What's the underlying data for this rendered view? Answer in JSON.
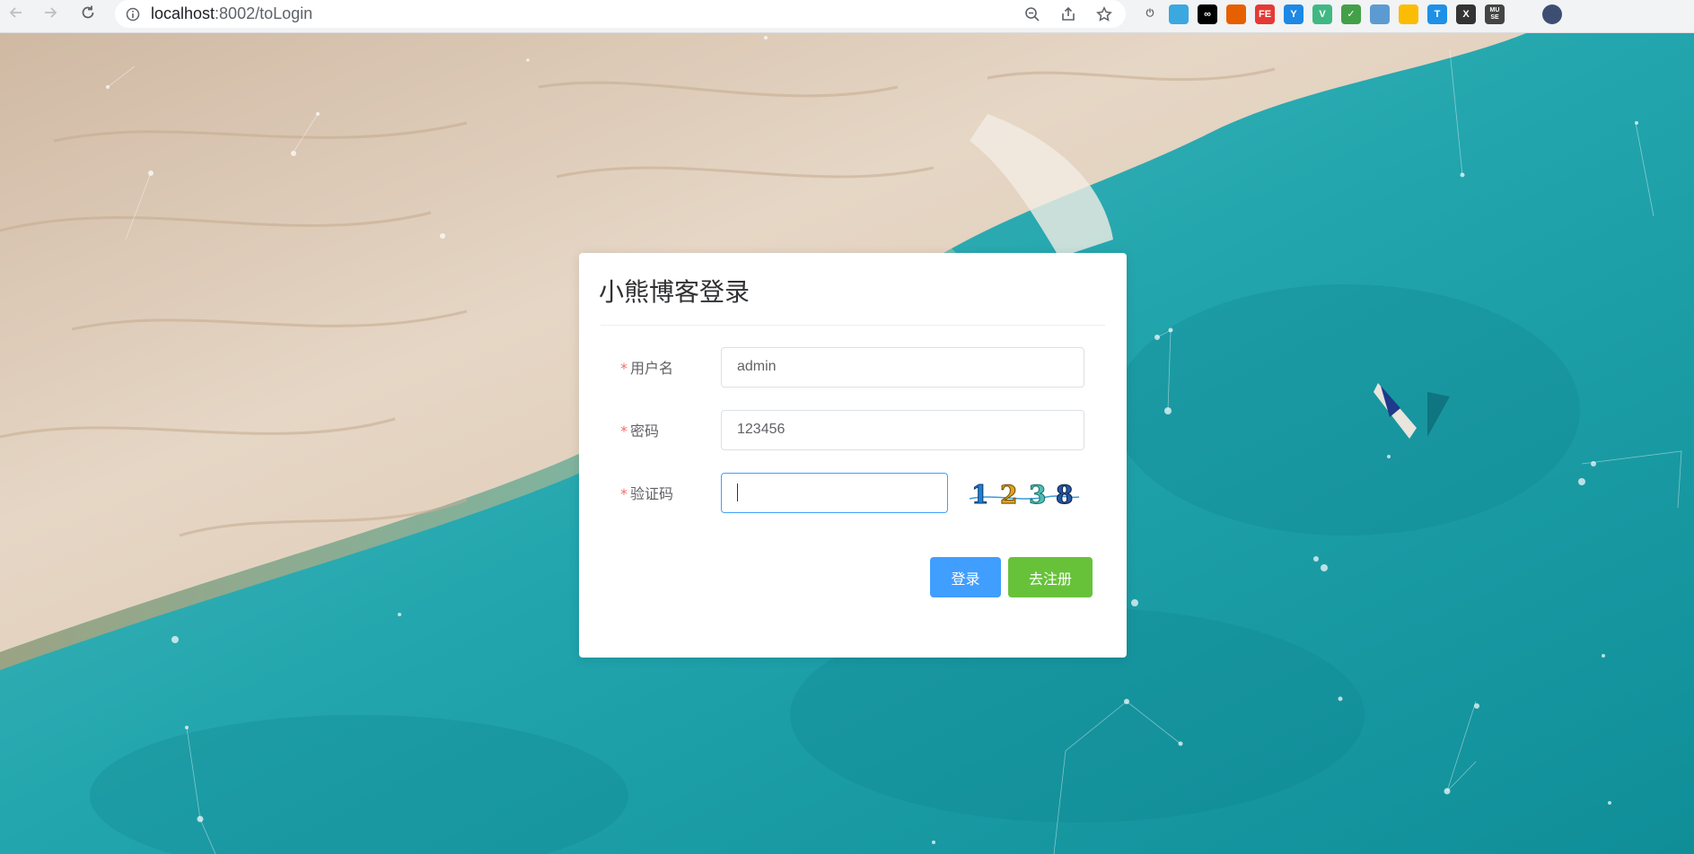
{
  "browser": {
    "url_host": "localhost",
    "url_rest": ":8002/toLogin",
    "extensions": [
      {
        "name": "power-icon",
        "label": "⏻",
        "color": "#5f6368"
      },
      {
        "name": "extension-cat-icon",
        "label": "",
        "color": "#3ba8e0"
      },
      {
        "name": "extension-infinity-icon",
        "label": "∞",
        "color": "#000000"
      },
      {
        "name": "extension-firefox-icon",
        "label": "",
        "color": "#e66000"
      },
      {
        "name": "extension-fe-icon",
        "label": "FE",
        "color": "#e53935"
      },
      {
        "name": "extension-y-icon",
        "label": "Y",
        "color": "#1e88e5"
      },
      {
        "name": "extension-vue-icon",
        "label": "V",
        "color": "#41b883"
      },
      {
        "name": "extension-shield-icon",
        "label": "✓",
        "color": "#43a047"
      },
      {
        "name": "extension-grid-icon",
        "label": "",
        "color": "#5c9bd1"
      },
      {
        "name": "extension-color-icon",
        "label": "",
        "color": "#fbbc05"
      },
      {
        "name": "extension-t-icon",
        "label": "T",
        "color": "#1e90e8"
      },
      {
        "name": "extension-x-icon",
        "label": "X",
        "color": "#333333"
      },
      {
        "name": "extension-muse-icon",
        "label": "MU SE",
        "color": "#444444"
      },
      {
        "name": "extensions-puzzle-icon",
        "label": "",
        "color": "#5f6368"
      },
      {
        "name": "profile-avatar-icon",
        "label": "",
        "color": "#3c4f72"
      }
    ]
  },
  "login": {
    "title": "小熊博客登录",
    "username_label": "用户名",
    "username_value": "admin",
    "password_label": "密码",
    "password_value": "123456",
    "captcha_label": "验证码",
    "captcha_value": "",
    "captcha_image_text": "1238",
    "required_mark": "*",
    "login_button": "登录",
    "register_button": "去注册"
  },
  "colors": {
    "primary": "#409eff",
    "success": "#67c23a",
    "required": "#f56c6c"
  }
}
